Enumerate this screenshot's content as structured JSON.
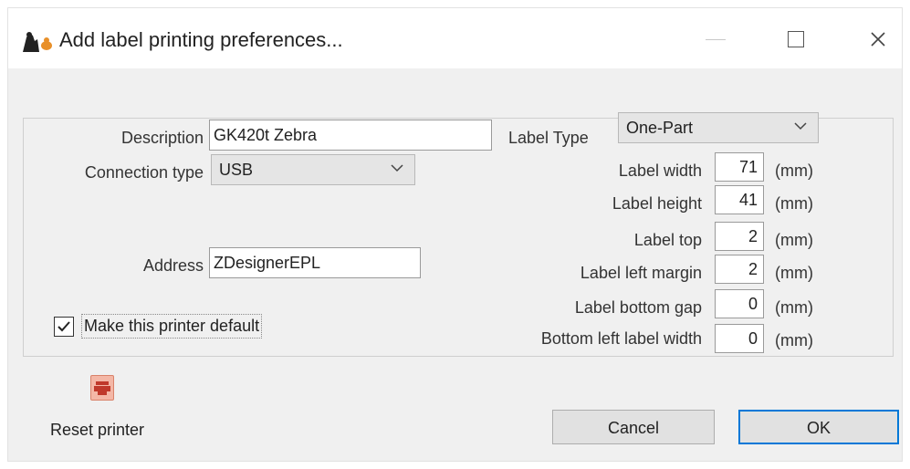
{
  "window": {
    "title": "Add label printing preferences...",
    "icons": {
      "app": "app-icon",
      "minimize": "minimize-icon",
      "maximize": "maximize-icon",
      "close": "close-icon"
    }
  },
  "form": {
    "description": {
      "label": "Description",
      "value": "GK420t Zebra"
    },
    "connection_type": {
      "label": "Connection type",
      "value": "USB"
    },
    "address": {
      "label": "Address",
      "value": "ZDesignerEPL"
    },
    "default_printer": {
      "label": "Make this printer default",
      "checked": true
    },
    "label_type": {
      "label": "Label Type",
      "value": "One-Part"
    },
    "unit": "(mm)",
    "dimensions": [
      {
        "label": "Label width",
        "value": "71"
      },
      {
        "label": "Label height",
        "value": "41"
      },
      {
        "label": "Label top",
        "value": "2"
      },
      {
        "label": "Label left margin",
        "value": "2"
      },
      {
        "label": "Label bottom gap",
        "value": "0"
      },
      {
        "label": "Bottom left label width",
        "value": "0"
      }
    ]
  },
  "actions": {
    "reset_printer": "Reset printer",
    "cancel": "Cancel",
    "ok": "OK"
  },
  "colors": {
    "accent": "#0078d7",
    "dialog_bg": "#f0f0f0",
    "reset_icon": "#f4b7a6"
  }
}
